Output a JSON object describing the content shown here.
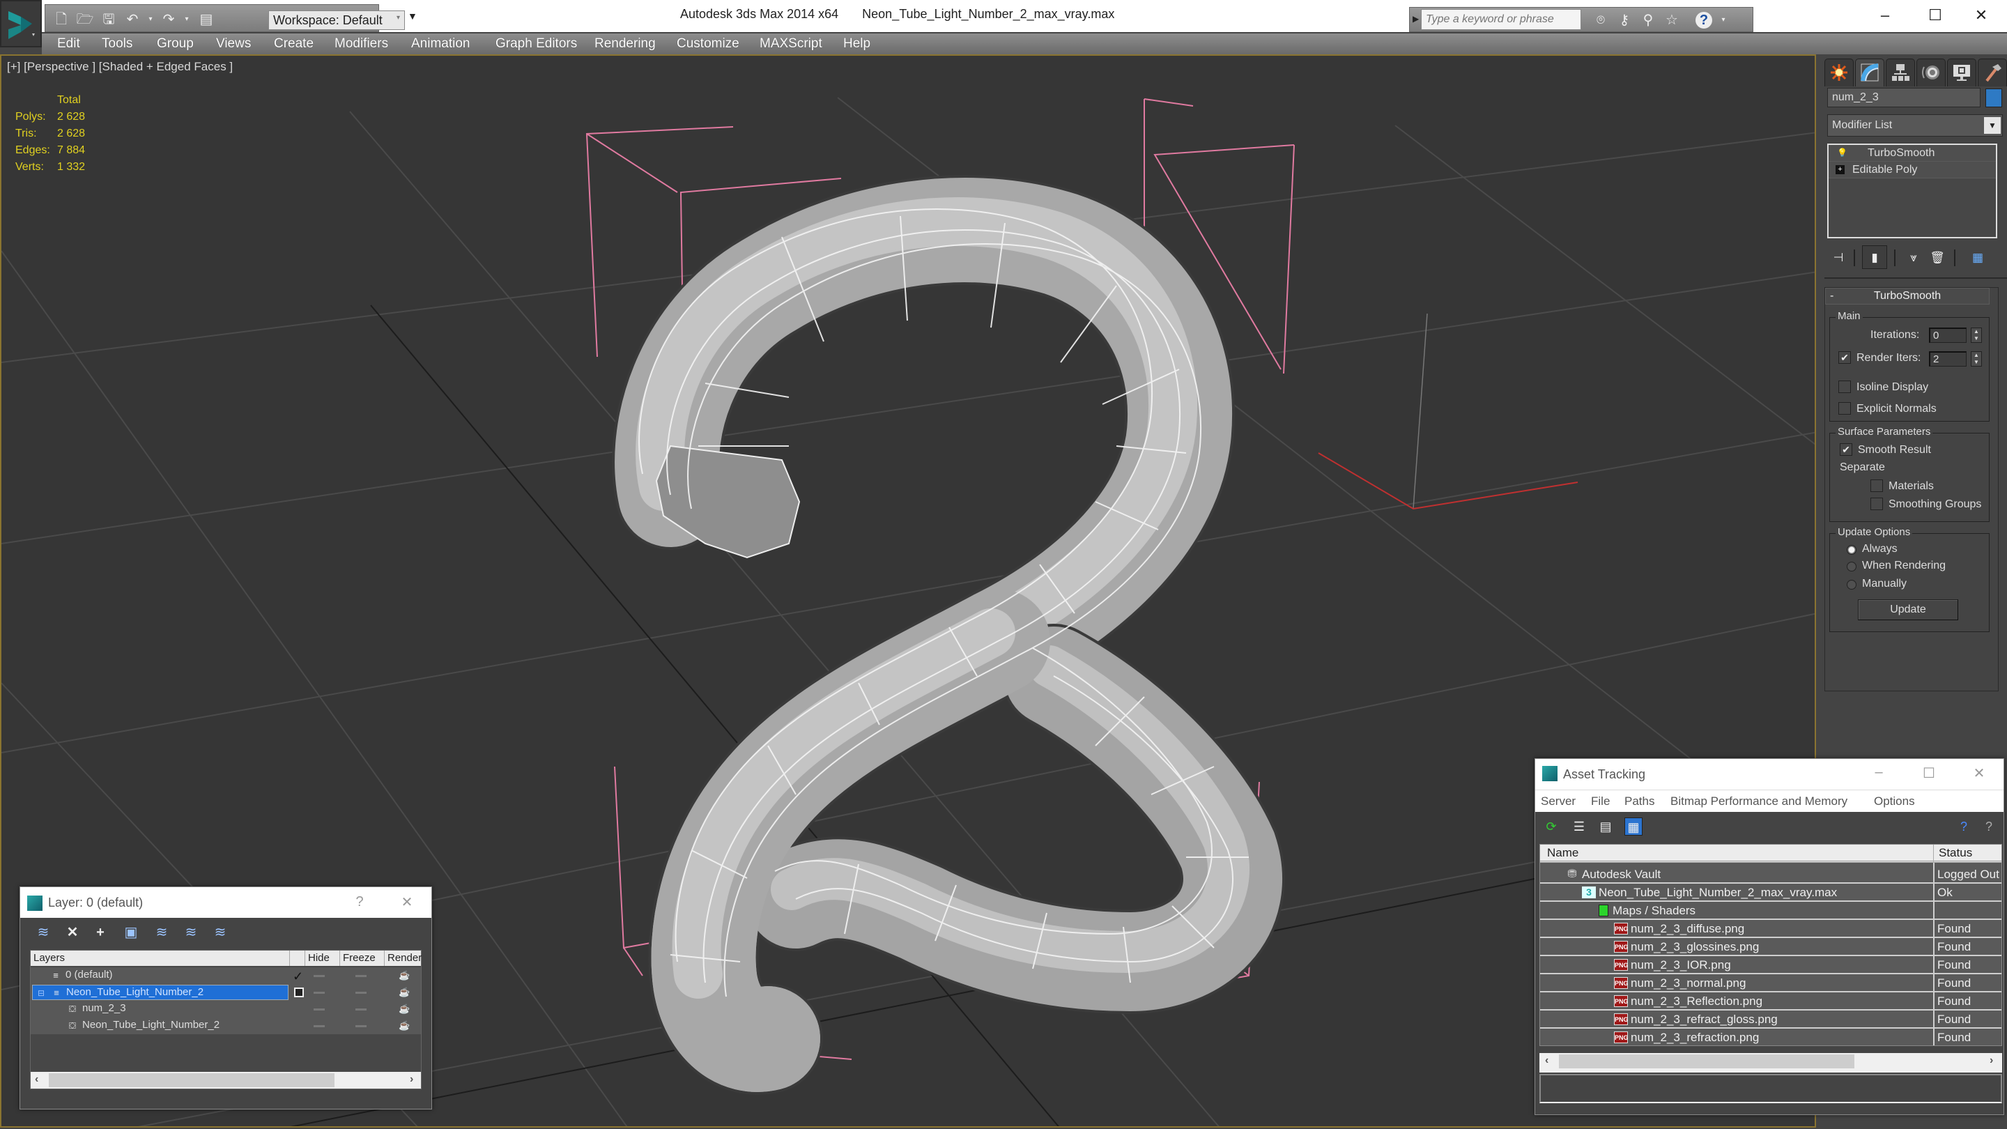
{
  "window": {
    "app_title": "Autodesk 3ds Max  2014 x64",
    "file_title": "Neon_Tube_Light_Number_2_max_vray.max",
    "minimize": "–",
    "maximize": "☐",
    "close": "✕"
  },
  "quick_access": {
    "workspace_label": "Workspace: Default",
    "search_placeholder": "Type a keyword or phrase"
  },
  "menu": [
    "Edit",
    "Tools",
    "Group",
    "Views",
    "Create",
    "Modifiers",
    "Animation",
    "Graph Editors",
    "Rendering",
    "Customize",
    "MAXScript",
    "Help"
  ],
  "viewport": {
    "label": "[+] [Perspective ] [Shaded + Edged Faces ]",
    "stats": {
      "header": "Total",
      "rows": [
        {
          "key": "Polys:",
          "value": "2 628"
        },
        {
          "key": "Tris:",
          "value": "2 628"
        },
        {
          "key": "Edges:",
          "value": "7 884"
        },
        {
          "key": "Verts:",
          "value": "1 332"
        }
      ]
    }
  },
  "command_panel": {
    "tabs": [
      "create",
      "modify",
      "hierarchy",
      "motion",
      "display",
      "utilities"
    ],
    "active_tab": "modify",
    "object_name": "num_2_3",
    "object_color": "#2e7ac4",
    "modifier_list_label": "Modifier List",
    "stack": [
      {
        "label": "TurboSmooth",
        "icon": "lightbulb-icon"
      },
      {
        "label": "Editable Poly",
        "icon": "expand-plus-icon"
      }
    ],
    "rollout": {
      "title": "TurboSmooth",
      "collapse": "-",
      "main_group": "Main",
      "iterations_label": "Iterations:",
      "iterations_value": "0",
      "render_iters_label": "Render Iters:",
      "render_iters_value": "2",
      "render_iters_checked": true,
      "isoline_label": "Isoline Display",
      "isoline_checked": false,
      "explicit_normals_label": "Explicit Normals",
      "explicit_normals_checked": false,
      "surface_group": "Surface Parameters",
      "smooth_result_label": "Smooth Result",
      "smooth_result_checked": true,
      "separate_label": "Separate",
      "materials_label": "Materials",
      "materials_checked": false,
      "smoothing_groups_label": "Smoothing Groups",
      "smoothing_groups_checked": false,
      "update_group": "Update Options",
      "update_options": [
        "Always",
        "When Rendering",
        "Manually"
      ],
      "update_selected": "Always",
      "update_button": "Update"
    }
  },
  "layer_window": {
    "title": "Layer: 0 (default)",
    "help": "?",
    "close": "✕",
    "columns": [
      "Layers",
      "",
      "Hide",
      "Freeze",
      "Render"
    ],
    "rows": [
      {
        "name": "0 (default)",
        "type": "layer",
        "current": true,
        "selected": false,
        "indent": 0
      },
      {
        "name": "Neon_Tube_Light_Number_2",
        "type": "layer",
        "current": false,
        "selected": true,
        "indent": 0,
        "expanded": true
      },
      {
        "name": "num_2_3",
        "type": "object",
        "current": false,
        "selected": false,
        "indent": 1
      },
      {
        "name": "Neon_Tube_Light_Number_2",
        "type": "object",
        "current": false,
        "selected": false,
        "indent": 1
      }
    ],
    "scroll_position": 0.0,
    "scroll_visible_fraction": 0.73
  },
  "asset_window": {
    "title": "Asset Tracking",
    "menu": [
      "Server",
      "File",
      "Paths",
      "Bitmap Performance and Memory",
      "Options"
    ],
    "columns": [
      "Name",
      "Status"
    ],
    "rows": [
      {
        "name": "Autodesk Vault",
        "status": "Logged Out",
        "icon": "vault",
        "indent": 0
      },
      {
        "name": "Neon_Tube_Light_Number_2_max_vray.max",
        "status": "Ok",
        "icon": "max",
        "indent": 1
      },
      {
        "name": "Maps / Shaders",
        "status": "",
        "icon": "maps",
        "indent": 2
      },
      {
        "name": "num_2_3_diffuse.png",
        "status": "Found",
        "icon": "png",
        "indent": 3
      },
      {
        "name": "num_2_3_glossines.png",
        "status": "Found",
        "icon": "png",
        "indent": 3
      },
      {
        "name": "num_2_3_IOR.png",
        "status": "Found",
        "icon": "png",
        "indent": 3
      },
      {
        "name": "num_2_3_normal.png",
        "status": "Found",
        "icon": "png",
        "indent": 3
      },
      {
        "name": "num_2_3_Reflection.png",
        "status": "Found",
        "icon": "png",
        "indent": 3
      },
      {
        "name": "num_2_3_refract_gloss.png",
        "status": "Found",
        "icon": "png",
        "indent": 3
      },
      {
        "name": "num_2_3_refraction.png",
        "status": "Found",
        "icon": "png",
        "indent": 3
      }
    ],
    "png_badge": "PNG",
    "max_badge": "3"
  }
}
